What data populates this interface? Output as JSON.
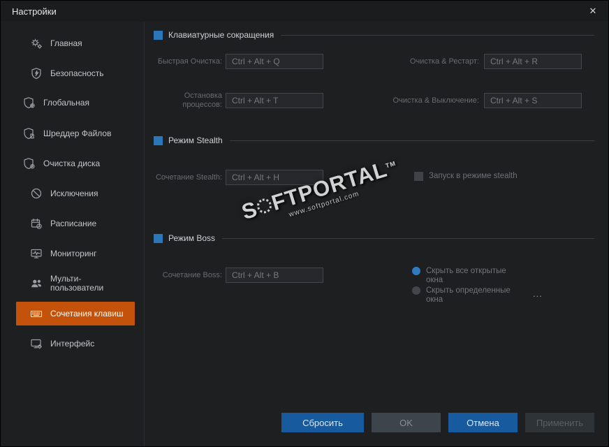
{
  "window": {
    "title": "Настройки",
    "close_glyph": "✕"
  },
  "sidebar": {
    "items": [
      {
        "label": "Главная"
      },
      {
        "label": "Безопасность"
      },
      {
        "label": "Глобальная"
      },
      {
        "label": "Шреддер Файлов"
      },
      {
        "label": "Очистка диска"
      },
      {
        "label": "Исключения"
      },
      {
        "label": "Расписание"
      },
      {
        "label": "Мониторинг"
      },
      {
        "label": "Мульти-пользователи"
      },
      {
        "label": "Сочетания клавиш"
      },
      {
        "label": "Интерфейс"
      }
    ],
    "selected_item": "Сочетания клавиш"
  },
  "sections": {
    "shortcuts": {
      "title": "Клавиатурные сокращения",
      "fields": [
        {
          "label": "Быстрая Очистка:",
          "value": "Ctrl + Alt + Q"
        },
        {
          "label": "Очистка & Рестарт:",
          "value": "Ctrl + Alt + R"
        },
        {
          "label": "Остановка процессов:",
          "value": "Ctrl + Alt + T"
        },
        {
          "label": "Очистка & Выключение:",
          "value": "Ctrl + Alt + S"
        }
      ]
    },
    "stealth": {
      "title": "Режим Stealth",
      "field": {
        "label": "Сочетание Stealth:",
        "value": "Ctrl + Alt + H"
      },
      "checkbox_label": "Запуск в режиме stealth",
      "checkbox_checked": false
    },
    "boss": {
      "title": "Режим Boss",
      "field": {
        "label": "Сочетание Boss:",
        "value": "Ctrl + Alt + B"
      },
      "radio_hide_all": "Скрыть все открытые окна",
      "radio_hide_specific": "Скрыть определенные окна",
      "radio_selected": "Скрыть все открытые окна",
      "more_label": "..."
    }
  },
  "footer": {
    "reset": "Сбросить",
    "ok": "OK",
    "cancel": "Отмена",
    "apply": "Применить"
  },
  "watermark": {
    "brand_left": "S",
    "brand_right": "FTPORTAL",
    "tm": "TM",
    "url": "www.softportal.com"
  },
  "colors": {
    "selected_sidebar_orange": "#c4520a",
    "section_checkbox_blue": "#2b77b8",
    "primary_button_blue": "#175a9e"
  }
}
